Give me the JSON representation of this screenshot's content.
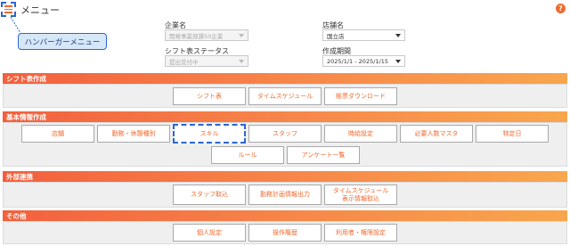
{
  "header": {
    "title": "メニュー",
    "callout_label": "ハンバーガーメニュー",
    "help_glyph": "?"
  },
  "filters": {
    "company_label": "企業名",
    "company_value": "開発事業部課50企業",
    "store_label": "店舗名",
    "store_value": "国立店",
    "shift_status_label": "シフト表ステータス",
    "shift_status_value": "提出受付中",
    "period_label": "作成期間",
    "period_value": "2025/1/1 - 2025/1/15"
  },
  "sections": {
    "shift": {
      "title": "シフト表作成",
      "buttons": [
        "シフト表",
        "タイムスケジュール",
        "帳票ダウンロード"
      ]
    },
    "basic": {
      "title": "基本情報作成",
      "buttons": [
        "店舗",
        "勤務・休憩種別",
        "スキル",
        "スタッフ",
        "時給設定",
        "必要人数マスタ",
        "特定日",
        "ルール",
        "アンケート一覧"
      ]
    },
    "external": {
      "title": "外部連携",
      "buttons": [
        "スタッフ取込",
        "勤務計画情報出力",
        "タイムスケジュール\n表示情報取込"
      ]
    },
    "other": {
      "title": "その他",
      "buttons": [
        "個人設定",
        "操作履歴",
        "利用者・権限設定"
      ]
    }
  },
  "colors": {
    "accent": "#ef6a2f",
    "highlight": "#2b67d1",
    "section_gradient_start": "#f2603e",
    "section_gradient_end": "#f8a64d"
  },
  "icons": {
    "menu": "hamburger-menu-icon",
    "help": "help-icon",
    "dropdown": "chevron-down-icon"
  }
}
